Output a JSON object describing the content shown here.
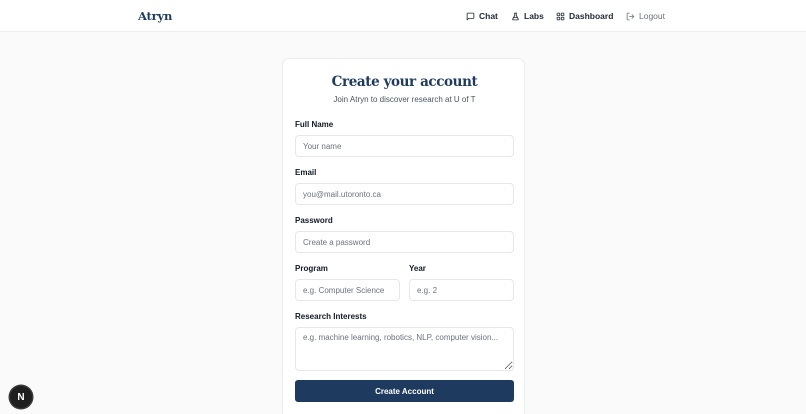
{
  "navbar": {
    "brand": "Atryn",
    "items": [
      {
        "label": "Chat",
        "icon": "chat-icon"
      },
      {
        "label": "Labs",
        "icon": "flask-icon"
      },
      {
        "label": "Dashboard",
        "icon": "grid-icon"
      },
      {
        "label": "Logout",
        "icon": "logout-icon"
      }
    ]
  },
  "form": {
    "title": "Create your account",
    "subtitle": "Join Atryn to discover research at U of T",
    "fields": {
      "full_name": {
        "label": "Full Name",
        "placeholder": "Your name",
        "value": ""
      },
      "email": {
        "label": "Email",
        "placeholder": "you@mail.utoronto.ca",
        "value": ""
      },
      "password": {
        "label": "Password",
        "placeholder": "Create a password",
        "value": ""
      },
      "program": {
        "label": "Program",
        "placeholder": "e.g. Computer Science",
        "value": ""
      },
      "year": {
        "label": "Year",
        "placeholder": "e.g. 2",
        "value": ""
      },
      "research_interests": {
        "label": "Research Interests",
        "placeholder": "e.g. machine learning, robotics, NLP, computer vision...",
        "value": ""
      }
    },
    "submit_label": "Create Account"
  },
  "dev_badge": {
    "label": "N",
    "icon": "nextjs-icon"
  },
  "colors": {
    "accent": "#1e3a5f",
    "background": "#fafafa",
    "card": "#ffffff",
    "muted_text": "#6b7280"
  }
}
